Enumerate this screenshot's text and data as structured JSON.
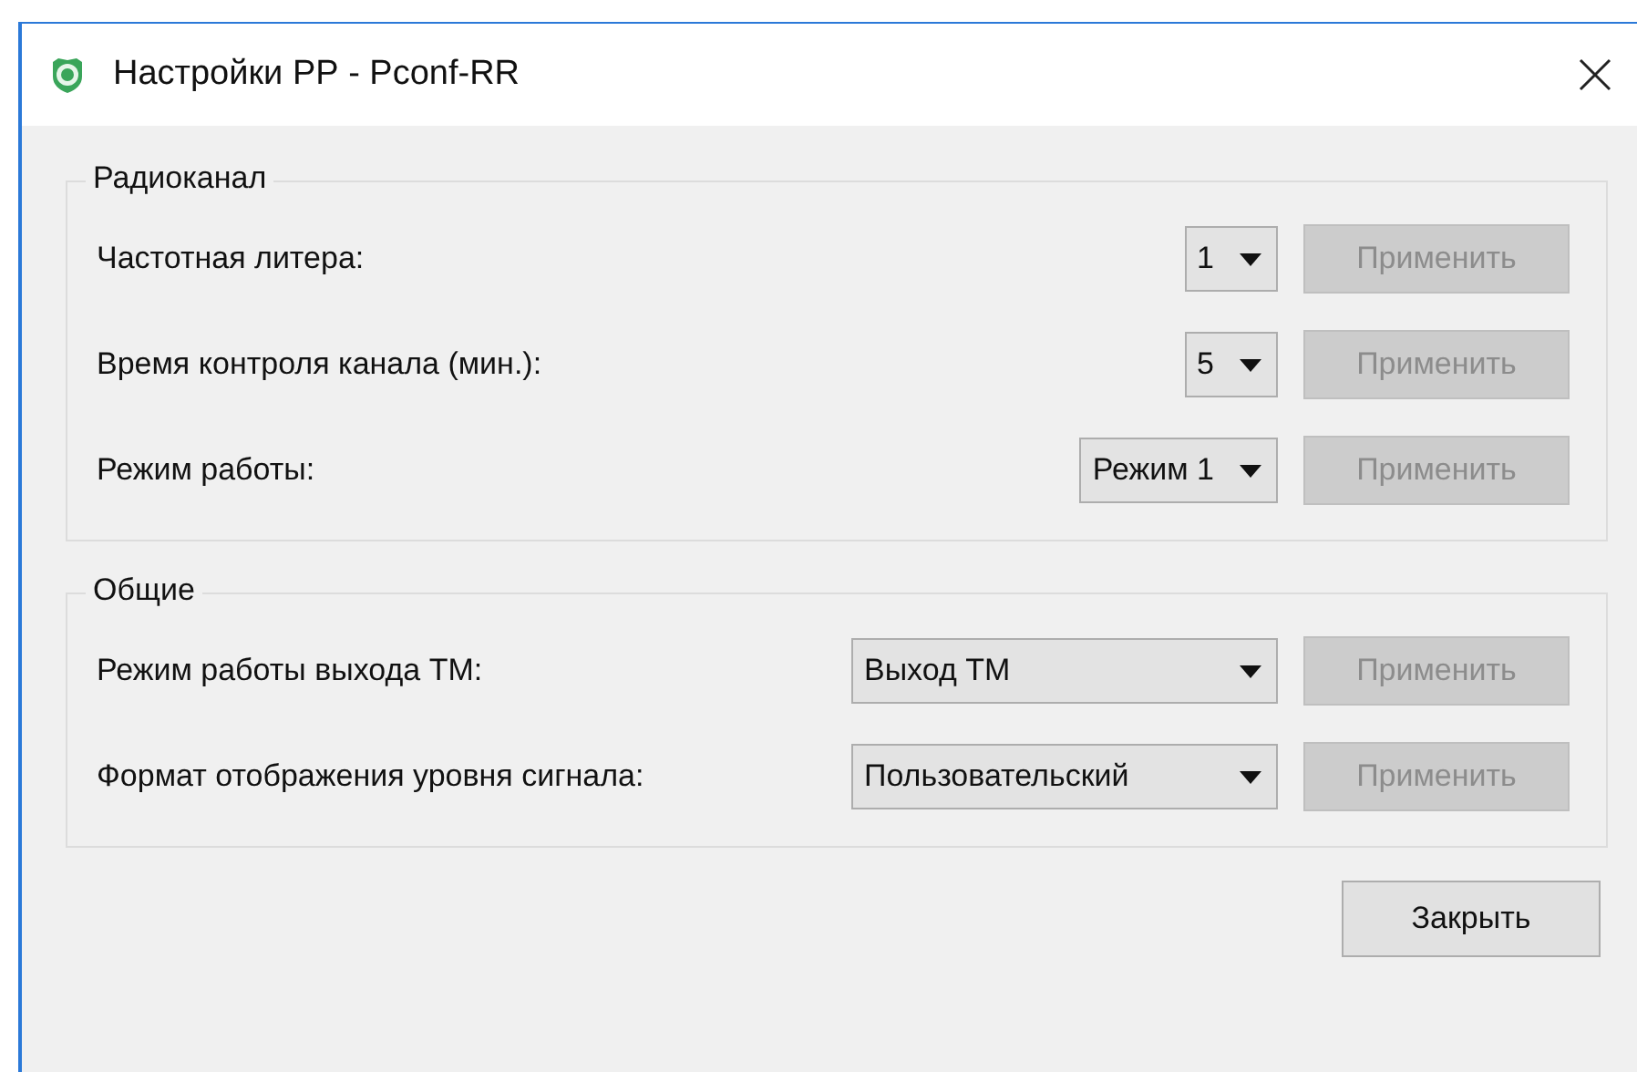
{
  "window": {
    "title": "Настройки РР - Pconf-RR"
  },
  "groups": [
    {
      "title": "Радиоканал",
      "kind": "compact",
      "rows": [
        {
          "label": "Частотная литера:",
          "value": "1",
          "apply": {
            "label": "Применить",
            "disabled": true
          }
        },
        {
          "label": "Время контроля канала (мин.):",
          "value": "5",
          "apply": {
            "label": "Применить",
            "disabled": true
          }
        },
        {
          "label": "Режим работы:",
          "value": "Режим 1",
          "apply": {
            "label": "Применить",
            "disabled": true
          }
        }
      ]
    },
    {
      "title": "Общие",
      "kind": "wide",
      "rows": [
        {
          "label": "Режим работы выхода ТМ:",
          "value": "Выход ТМ",
          "apply": {
            "label": "Применить",
            "disabled": true
          }
        },
        {
          "label": "Формат отображения уровня сигнала:",
          "value": "Пользовательский",
          "apply": {
            "label": "Применить",
            "disabled": true
          }
        }
      ]
    }
  ],
  "buttons": [
    {
      "label": "Закрыть"
    }
  ]
}
